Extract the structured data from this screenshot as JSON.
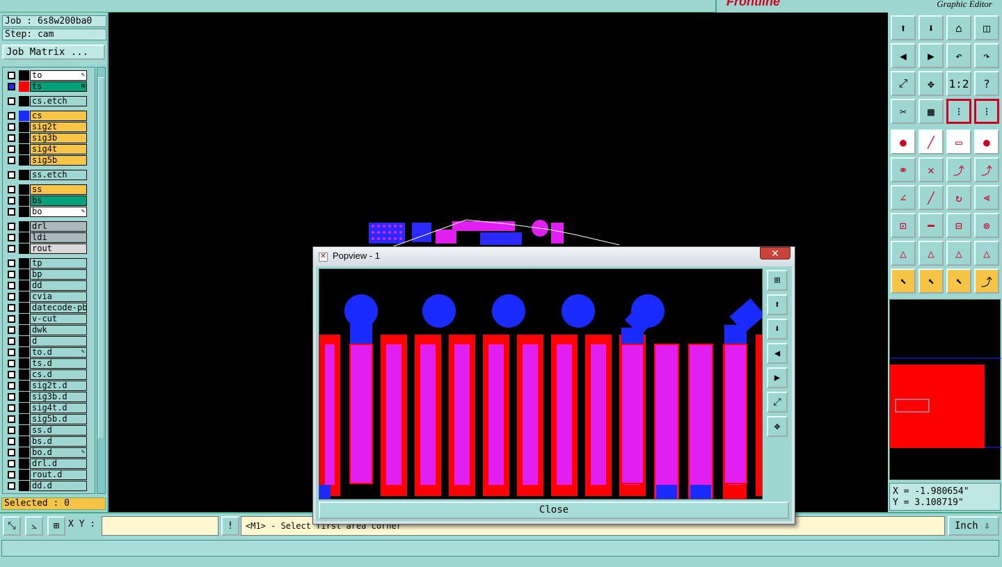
{
  "app": {
    "brand_title": "Graphic Editor"
  },
  "left_panel": {
    "job": "Job : 6s8w200ba0",
    "step": "Step: cam",
    "job_matrix_button": "Job Matrix ...",
    "selected": "Selected : 0"
  },
  "layers": [
    {
      "name": "to",
      "color": "#ffffff",
      "swatch": "#000000",
      "flag": "✎"
    },
    {
      "name": "ts",
      "color": "#00a07a",
      "swatch": "#ff0000",
      "flag": "⊞"
    },
    {
      "name": "cs.etch",
      "color": "#9ed6d2",
      "swatch": "#000000",
      "flag": ""
    },
    {
      "name": "cs",
      "color": "#f6c447",
      "swatch": "#1a2bff",
      "flag": ""
    },
    {
      "name": "sig2t",
      "color": "#f6c447",
      "swatch": "#000000",
      "flag": ""
    },
    {
      "name": "sig3b",
      "color": "#f6c447",
      "swatch": "#000000",
      "flag": ""
    },
    {
      "name": "sig4t",
      "color": "#f6c447",
      "swatch": "#000000",
      "flag": ""
    },
    {
      "name": "sig5b",
      "color": "#f6c447",
      "swatch": "#000000",
      "flag": ""
    },
    {
      "name": "ss.etch",
      "color": "#9ed6d2",
      "swatch": "#000000",
      "flag": ""
    },
    {
      "name": "ss",
      "color": "#f6c447",
      "swatch": "#000000",
      "flag": ""
    },
    {
      "name": "bs",
      "color": "#00a07a",
      "swatch": "#000000",
      "flag": ""
    },
    {
      "name": "bo",
      "color": "#ffffff",
      "swatch": "#000000",
      "flag": "✎"
    },
    {
      "name": "drl",
      "color": "#a9b8bc",
      "swatch": "#000000",
      "flag": ""
    },
    {
      "name": "ldi",
      "color": "#a9b8bc",
      "swatch": "#000000",
      "flag": ""
    },
    {
      "name": "rout",
      "color": "#d9d9d9",
      "swatch": "#000000",
      "flag": ""
    },
    {
      "name": "tp",
      "color": "#9ed6d2",
      "swatch": "#000000",
      "flag": ""
    },
    {
      "name": "bp",
      "color": "#9ed6d2",
      "swatch": "#000000",
      "flag": ""
    },
    {
      "name": "dd",
      "color": "#9ed6d2",
      "swatch": "#000000",
      "flag": ""
    },
    {
      "name": "cvia",
      "color": "#9ed6d2",
      "swatch": "#000000",
      "flag": ""
    },
    {
      "name": "datecode-pbe",
      "color": "#9ed6d2",
      "swatch": "#000000",
      "flag": ""
    },
    {
      "name": "v-cut",
      "color": "#9ed6d2",
      "swatch": "#000000",
      "flag": ""
    },
    {
      "name": "dwk",
      "color": "#9ed6d2",
      "swatch": "#000000",
      "flag": ""
    },
    {
      "name": "d",
      "color": "#9ed6d2",
      "swatch": "#000000",
      "flag": ""
    },
    {
      "name": "to.d",
      "color": "#9ed6d2",
      "swatch": "#000000",
      "flag": "✎"
    },
    {
      "name": "ts.d",
      "color": "#9ed6d2",
      "swatch": "#000000",
      "flag": ""
    },
    {
      "name": "cs.d",
      "color": "#9ed6d2",
      "swatch": "#000000",
      "flag": ""
    },
    {
      "name": "sig2t.d",
      "color": "#9ed6d2",
      "swatch": "#000000",
      "flag": ""
    },
    {
      "name": "sig3b.d",
      "color": "#9ed6d2",
      "swatch": "#000000",
      "flag": ""
    },
    {
      "name": "sig4t.d",
      "color": "#9ed6d2",
      "swatch": "#000000",
      "flag": ""
    },
    {
      "name": "sig5b.d",
      "color": "#9ed6d2",
      "swatch": "#000000",
      "flag": ""
    },
    {
      "name": "ss.d",
      "color": "#9ed6d2",
      "swatch": "#000000",
      "flag": ""
    },
    {
      "name": "bs.d",
      "color": "#9ed6d2",
      "swatch": "#000000",
      "flag": ""
    },
    {
      "name": "bo.d",
      "color": "#9ed6d2",
      "swatch": "#000000",
      "flag": "✎"
    },
    {
      "name": "drl.d",
      "color": "#9ed6d2",
      "swatch": "#000000",
      "flag": ""
    },
    {
      "name": "rout.d",
      "color": "#9ed6d2",
      "swatch": "#000000",
      "flag": ""
    },
    {
      "name": "dd.d",
      "color": "#9ed6d2",
      "swatch": "#000000",
      "flag": ""
    }
  ],
  "right_panel": {
    "x": "X = -1.980654\"",
    "y": "Y = 3.108719\""
  },
  "bottom_bar": {
    "xy_label": "X Y :",
    "xy_value": "",
    "message": "<M1> - Select first area corner",
    "unit": "Inch"
  },
  "popview": {
    "title": "Popview - 1",
    "close_button": "Close"
  },
  "colors": {
    "panel": "#9ed6d2",
    "highlight": "#f6c447",
    "copper_red": "#ff0000",
    "copper_blue": "#1a2bff",
    "magenta": "#e01ff0"
  }
}
